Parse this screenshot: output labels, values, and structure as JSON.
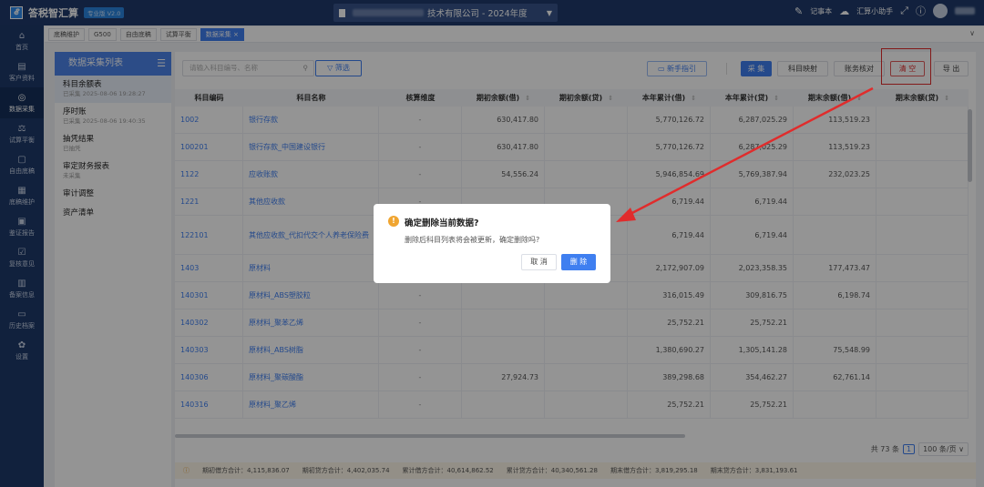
{
  "topbar": {
    "app_name": "答税智汇算",
    "version": "专业版 V2.0",
    "company": "技术有限公司 - 2024年度",
    "notebook": "记事本",
    "assistant": "汇算小助手"
  },
  "sidebar": [
    {
      "icon": "home-icon",
      "label": "首页"
    },
    {
      "icon": "client-icon",
      "label": "客户资料"
    },
    {
      "icon": "database-icon",
      "label": "数据采集"
    },
    {
      "icon": "balance-icon",
      "label": "试算平衡"
    },
    {
      "icon": "draft-icon",
      "label": "自由底稿"
    },
    {
      "icon": "maintain-icon",
      "label": "底稿维护"
    },
    {
      "icon": "report-icon",
      "label": "鉴证报告"
    },
    {
      "icon": "review-icon",
      "label": "复核意见"
    },
    {
      "icon": "file-icon",
      "label": "备案信息"
    },
    {
      "icon": "folder-icon",
      "label": "历史档案"
    },
    {
      "icon": "settings-icon",
      "label": "设置"
    }
  ],
  "tabs": [
    "底稿维护",
    "G500",
    "自由底稿",
    "试算平衡",
    "数据采集"
  ],
  "left_panel": {
    "title": "数据采集列表",
    "items": [
      {
        "title": "科目余额表",
        "sub": "已采集 2025-08-06 19:28:27"
      },
      {
        "title": "序时账",
        "sub": "已采集 2025-08-06 19:40:35"
      },
      {
        "title": "抽凭结果",
        "sub": "已抽凭"
      },
      {
        "title": "审定财务报表",
        "sub": "未采集"
      },
      {
        "title": "审计调整",
        "sub": ""
      },
      {
        "title": "资产清单",
        "sub": ""
      }
    ]
  },
  "toolbar": {
    "search_placeholder": "请输入科目编号、名称",
    "filter": "筛选",
    "guide": "新手指引",
    "collect": "采 集",
    "map": "科目映射",
    "check": "账务核对",
    "clear": "清 空",
    "export": "导 出"
  },
  "table": {
    "headers": [
      "科目编码",
      "科目名称",
      "核算维度",
      "期初余额(借)",
      "期初余额(贷)",
      "本年累计(借)",
      "本年累计(贷)",
      "期末余额(借)",
      "期末余额(贷)"
    ],
    "rows": [
      [
        "1002",
        "银行存款",
        "-",
        "630,417.80",
        "",
        "5,770,126.72",
        "6,287,025.29",
        "113,519.23",
        ""
      ],
      [
        "100201",
        "银行存款_中国建设银行",
        "-",
        "630,417.80",
        "",
        "5,770,126.72",
        "6,287,025.29",
        "113,519.23",
        ""
      ],
      [
        "1122",
        "应收账款",
        "-",
        "54,556.24",
        "",
        "5,946,854.69",
        "5,769,387.94",
        "232,023.25",
        ""
      ],
      [
        "1221",
        "其他应收款",
        "-",
        "",
        "",
        "6,719.44",
        "6,719.44",
        "",
        ""
      ],
      [
        "122101",
        "其他应收款_代扣代交个人养老保险费",
        "-",
        "",
        "",
        "6,719.44",
        "6,719.44",
        "",
        ""
      ],
      [
        "1403",
        "原材料",
        "-",
        "",
        "",
        "2,172,907.09",
        "2,023,358.35",
        "177,473.47",
        ""
      ],
      [
        "140301",
        "原材料_ABS塑胶粒",
        "-",
        "",
        "",
        "316,015.49",
        "309,816.75",
        "6,198.74",
        ""
      ],
      [
        "140302",
        "原材料_聚苯乙烯",
        "-",
        "",
        "",
        "25,752.21",
        "25,752.21",
        "",
        ""
      ],
      [
        "140303",
        "原材料_ABS树脂",
        "-",
        "",
        "",
        "1,380,690.27",
        "1,305,141.28",
        "75,548.99",
        ""
      ],
      [
        "140306",
        "原材料_聚碳酸酯",
        "-",
        "27,924.73",
        "",
        "389,298.68",
        "354,462.27",
        "62,761.14",
        ""
      ],
      [
        "140316",
        "原材料_聚乙烯",
        "-",
        "",
        "",
        "25,752.21",
        "25,752.21",
        "",
        ""
      ]
    ]
  },
  "pagination": {
    "total": "共 73 条",
    "page": "1",
    "size": "100 条/页"
  },
  "footer": {
    "open_debit": "期初借方合计：4,115,836.07",
    "open_credit": "期初贷方合计：4,402,035.74",
    "acc_debit": "累计借方合计：40,614,862.52",
    "acc_credit": "累计贷方合计：40,340,561.28",
    "end_debit": "期末借方合计：3,819,295.18",
    "end_credit": "期末贷方合计：3,831,193.61"
  },
  "dialog": {
    "title": "确定删除当前数据?",
    "message": "删除后科目列表将会被更新，确定删除吗?",
    "cancel": "取 消",
    "confirm": "删 除"
  },
  "colors": {
    "primary": "#3f7ff0",
    "nav": "#1e3a6a",
    "danger": "#e02c2c",
    "warning": "#f0a531"
  }
}
